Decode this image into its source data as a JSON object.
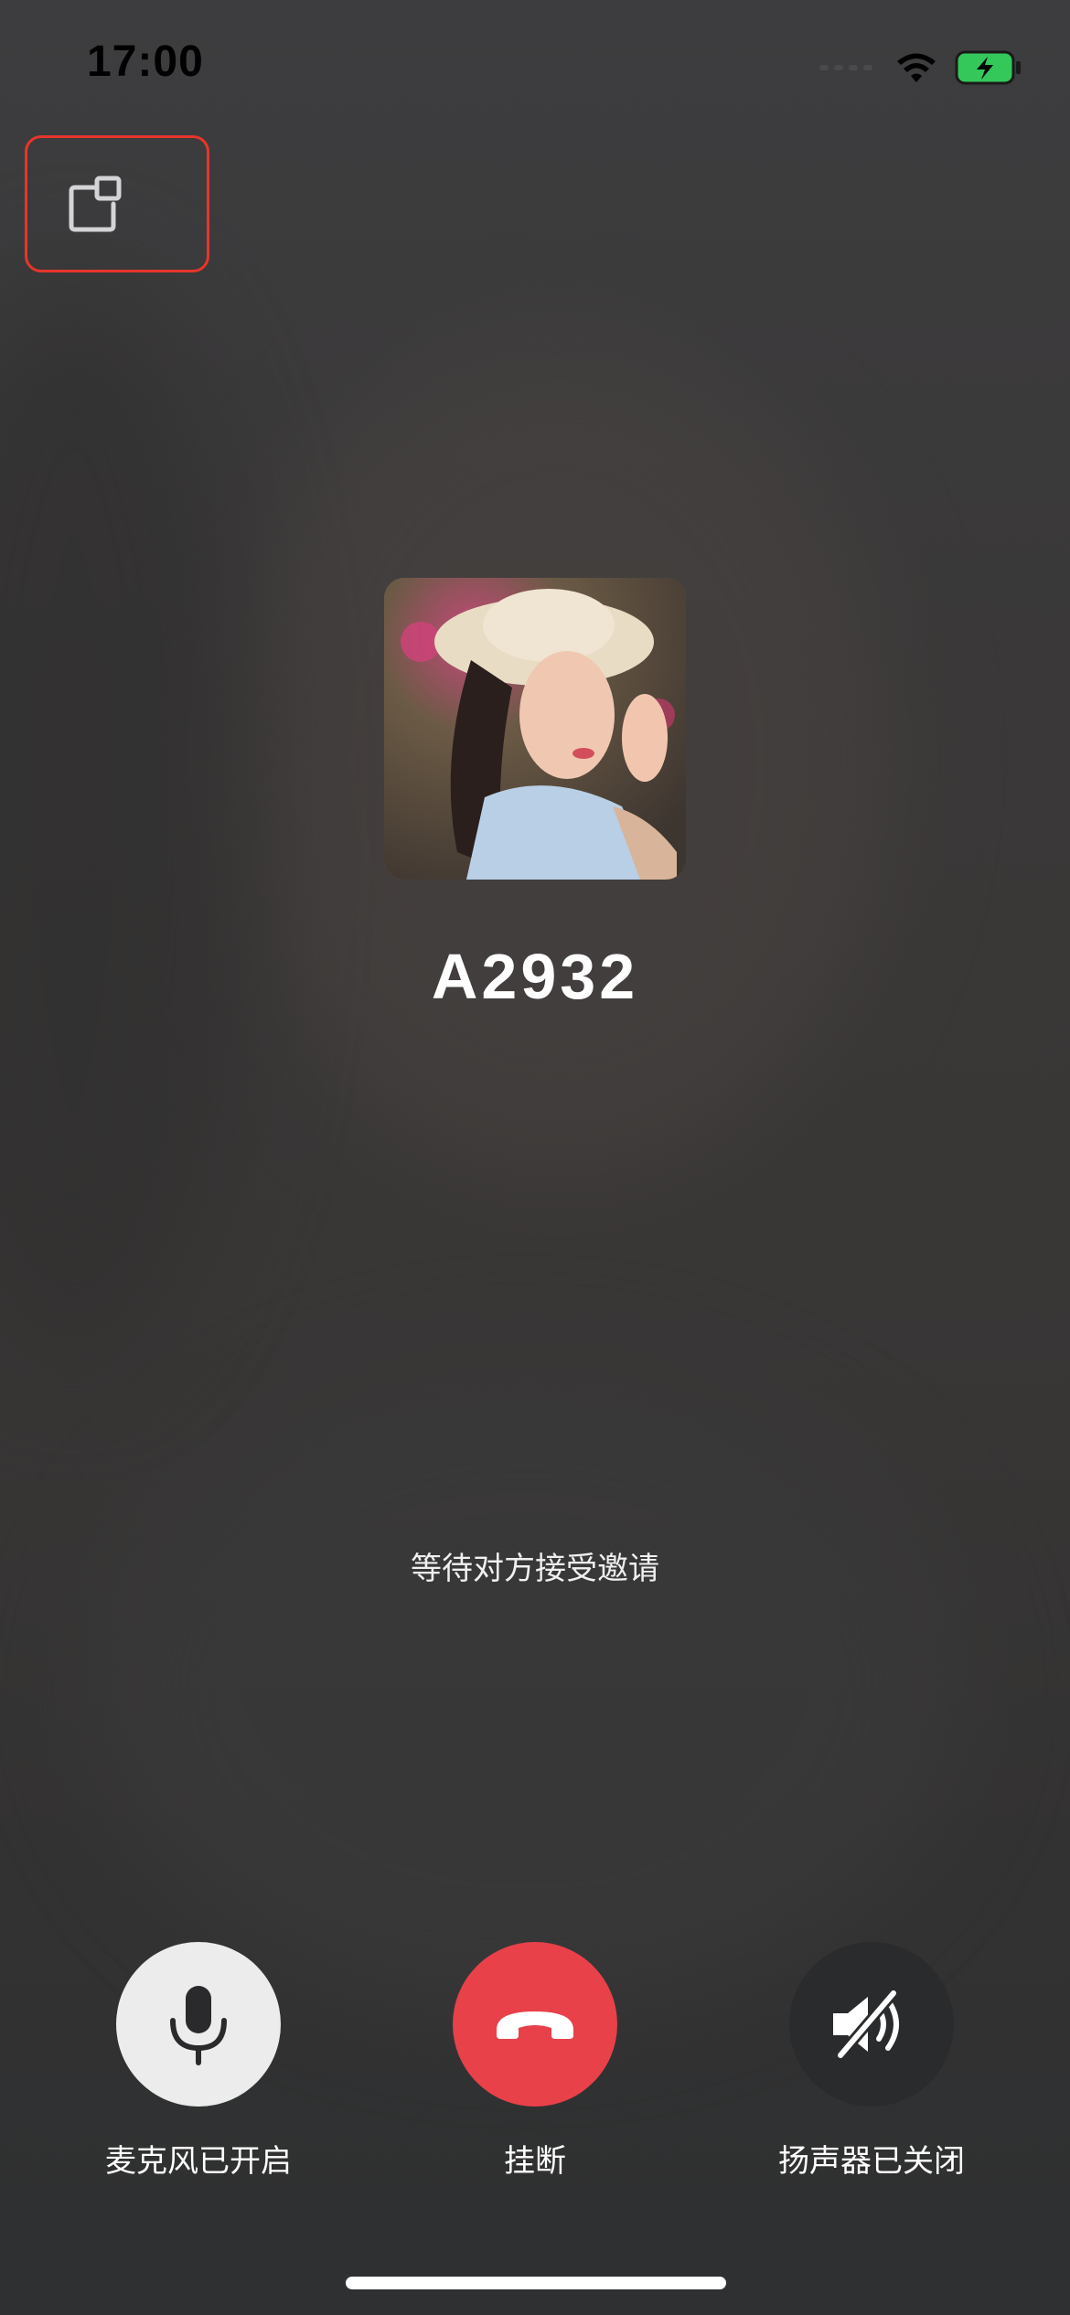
{
  "status_bar": {
    "time": "17:00",
    "signal_icon": "signal-dots-icon",
    "wifi_icon": "wifi-icon",
    "battery_icon": "battery-charging-icon",
    "battery_color": "#34c759"
  },
  "top_controls": {
    "pip_icon": "picture-in-picture-icon",
    "highlight_color": "#e8352a"
  },
  "caller": {
    "name": "A2932",
    "avatar": "caller-avatar"
  },
  "call": {
    "status_text": "等待对方接受邀请"
  },
  "controls": {
    "microphone": {
      "label": "麦克风已开启",
      "icon": "microphone-icon",
      "color": "#ececec"
    },
    "hangup": {
      "label": "挂断",
      "icon": "phone-hangup-icon",
      "color": "#e8414a"
    },
    "speaker": {
      "label": "扬声器已关闭",
      "icon": "speaker-muted-icon",
      "color": "#2a2b2d"
    }
  }
}
